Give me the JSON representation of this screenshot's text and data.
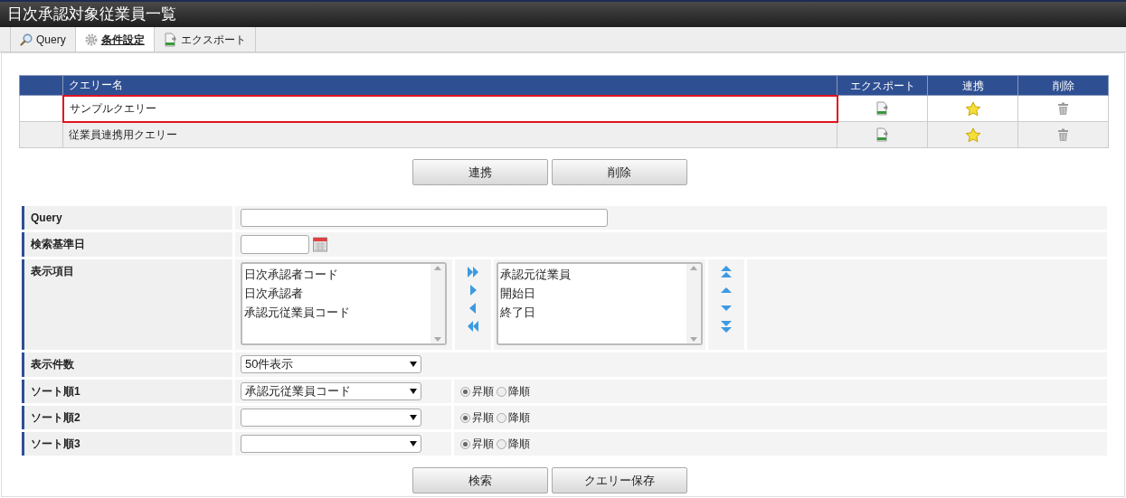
{
  "window": {
    "title": "日次承認対象従業員一覧"
  },
  "tabs": [
    {
      "label": "Query",
      "selected": false
    },
    {
      "label": "条件設定",
      "selected": true
    },
    {
      "label": "エクスポート",
      "selected": false
    }
  ],
  "query_table": {
    "columns": [
      "クエリー名",
      "エクスポート",
      "連携",
      "削除"
    ],
    "rows": [
      {
        "name": "サンプルクエリー",
        "selected": true
      },
      {
        "name": "従業員連携用クエリー",
        "selected": false
      }
    ]
  },
  "table_buttons": [
    "連携",
    "削除"
  ],
  "form": {
    "query": {
      "label": "Query"
    },
    "base_date": {
      "label": "検索基準日"
    },
    "display_items": {
      "label": "表示項目",
      "available": [
        "日次承認者コード",
        "日次承認者",
        "承認元従業員コード"
      ],
      "chosen": [
        "承認元従業員",
        "開始日",
        "終了日"
      ]
    },
    "page_size": {
      "label": "表示件数",
      "value": "50件表示"
    },
    "sorts": [
      {
        "label": "ソート順1",
        "value": "承認元従業員コード",
        "options": [
          {
            "label": "昇順",
            "selected": true
          },
          {
            "label": "降順",
            "selected": false
          }
        ]
      },
      {
        "label": "ソート順2",
        "options": [
          {
            "label": "昇順",
            "selected": true
          },
          {
            "label": "降順",
            "selected": false
          }
        ]
      },
      {
        "label": "ソート順3",
        "options": [
          {
            "label": "昇順",
            "selected": true
          },
          {
            "label": "降順",
            "selected": false
          }
        ]
      }
    ]
  },
  "buttons": [
    "検索",
    "クエリー保存"
  ]
}
